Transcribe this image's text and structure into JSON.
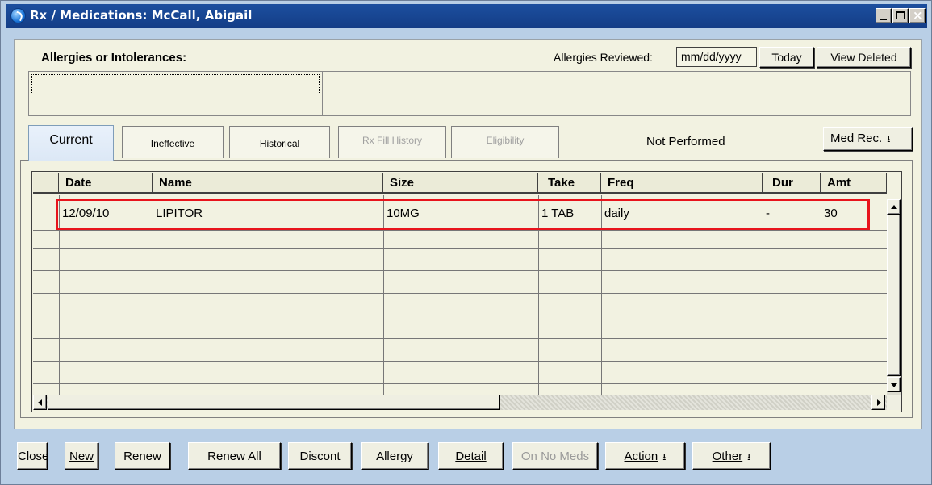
{
  "window": {
    "title": "Rx / Medications: McCall, Abigail"
  },
  "allergies": {
    "heading": "Allergies or Intolerances:",
    "reviewed_label": "Allergies Reviewed:",
    "reviewed_date_placeholder": "mm/dd/yyyy",
    "today_button": "Today",
    "view_deleted_button": "View Deleted"
  },
  "tabs": [
    {
      "label": "Current",
      "active": true
    },
    {
      "label": "Ineffective",
      "active": false
    },
    {
      "label": "Historical",
      "active": false
    },
    {
      "label": "Rx Fill History",
      "active": false,
      "disabled": true
    },
    {
      "label": "Eligibility",
      "active": false,
      "disabled": true
    }
  ],
  "status_text": "Not Performed",
  "med_rec_button": "Med Rec.",
  "med_table": {
    "columns": [
      "Date",
      "Name",
      "Size",
      "Take",
      "Freq",
      "Dur",
      "Amt"
    ],
    "rows": [
      {
        "date": "12/09/10",
        "name": "LIPITOR",
        "size": "10MG",
        "take": "1 TAB",
        "freq": "daily",
        "dur": "-",
        "amt": "30"
      }
    ]
  },
  "highlight_color": "#e8141c",
  "bottom_buttons": {
    "close": "Close",
    "new": "New",
    "renew": "Renew",
    "renew_all": "Renew All",
    "discont": "Discont",
    "allergy": "Allergy",
    "detail": "Detail",
    "on_no_meds": "On No Meds",
    "action": "Action",
    "other": "Other"
  }
}
